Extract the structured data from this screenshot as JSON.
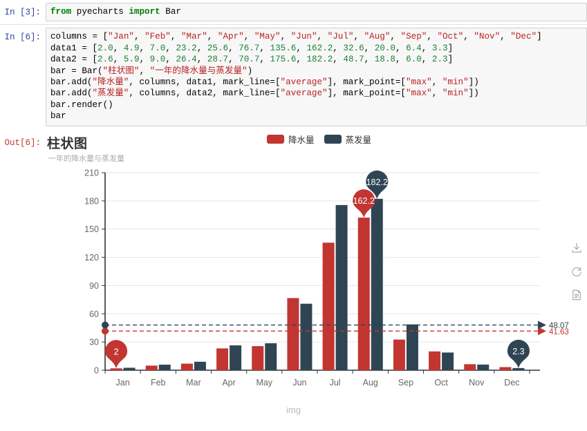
{
  "notebook": {
    "cells": [
      {
        "prompt": "In [3]:",
        "lines": [
          [
            {
              "t": "from ",
              "c": "k"
            },
            {
              "t": "pyecharts ",
              "c": "p"
            },
            {
              "t": "import ",
              "c": "k"
            },
            {
              "t": "Bar",
              "c": "p"
            }
          ]
        ]
      },
      {
        "prompt": "In [6]:",
        "lines": [
          [
            {
              "t": "columns = [",
              "c": "p"
            },
            {
              "t": "\"Jan\"",
              "c": "s"
            },
            {
              "t": ", ",
              "c": "p"
            },
            {
              "t": "\"Feb\"",
              "c": "s"
            },
            {
              "t": ", ",
              "c": "p"
            },
            {
              "t": "\"Mar\"",
              "c": "s"
            },
            {
              "t": ", ",
              "c": "p"
            },
            {
              "t": "\"Apr\"",
              "c": "s"
            },
            {
              "t": ", ",
              "c": "p"
            },
            {
              "t": "\"May\"",
              "c": "s"
            },
            {
              "t": ", ",
              "c": "p"
            },
            {
              "t": "\"Jun\"",
              "c": "s"
            },
            {
              "t": ", ",
              "c": "p"
            },
            {
              "t": "\"Jul\"",
              "c": "s"
            },
            {
              "t": ", ",
              "c": "p"
            },
            {
              "t": "\"Aug\"",
              "c": "s"
            },
            {
              "t": ", ",
              "c": "p"
            },
            {
              "t": "\"Sep\"",
              "c": "s"
            },
            {
              "t": ", ",
              "c": "p"
            },
            {
              "t": "\"Oct\"",
              "c": "s"
            },
            {
              "t": ", ",
              "c": "p"
            },
            {
              "t": "\"Nov\"",
              "c": "s"
            },
            {
              "t": ", ",
              "c": "p"
            },
            {
              "t": "\"Dec\"",
              "c": "s"
            },
            {
              "t": "]",
              "c": "p"
            }
          ],
          [
            {
              "t": "data1 = [",
              "c": "p"
            },
            {
              "t": "2.0",
              "c": "n"
            },
            {
              "t": ", ",
              "c": "p"
            },
            {
              "t": "4.9",
              "c": "n"
            },
            {
              "t": ", ",
              "c": "p"
            },
            {
              "t": "7.0",
              "c": "n"
            },
            {
              "t": ", ",
              "c": "p"
            },
            {
              "t": "23.2",
              "c": "n"
            },
            {
              "t": ", ",
              "c": "p"
            },
            {
              "t": "25.6",
              "c": "n"
            },
            {
              "t": ", ",
              "c": "p"
            },
            {
              "t": "76.7",
              "c": "n"
            },
            {
              "t": ", ",
              "c": "p"
            },
            {
              "t": "135.6",
              "c": "n"
            },
            {
              "t": ", ",
              "c": "p"
            },
            {
              "t": "162.2",
              "c": "n"
            },
            {
              "t": ", ",
              "c": "p"
            },
            {
              "t": "32.6",
              "c": "n"
            },
            {
              "t": ", ",
              "c": "p"
            },
            {
              "t": "20.0",
              "c": "n"
            },
            {
              "t": ", ",
              "c": "p"
            },
            {
              "t": "6.4",
              "c": "n"
            },
            {
              "t": ", ",
              "c": "p"
            },
            {
              "t": "3.3",
              "c": "n"
            },
            {
              "t": "]",
              "c": "p"
            }
          ],
          [
            {
              "t": "data2 = [",
              "c": "p"
            },
            {
              "t": "2.6",
              "c": "n"
            },
            {
              "t": ", ",
              "c": "p"
            },
            {
              "t": "5.9",
              "c": "n"
            },
            {
              "t": ", ",
              "c": "p"
            },
            {
              "t": "9.0",
              "c": "n"
            },
            {
              "t": ", ",
              "c": "p"
            },
            {
              "t": "26.4",
              "c": "n"
            },
            {
              "t": ", ",
              "c": "p"
            },
            {
              "t": "28.7",
              "c": "n"
            },
            {
              "t": ", ",
              "c": "p"
            },
            {
              "t": "70.7",
              "c": "n"
            },
            {
              "t": ", ",
              "c": "p"
            },
            {
              "t": "175.6",
              "c": "n"
            },
            {
              "t": ", ",
              "c": "p"
            },
            {
              "t": "182.2",
              "c": "n"
            },
            {
              "t": ", ",
              "c": "p"
            },
            {
              "t": "48.7",
              "c": "n"
            },
            {
              "t": ", ",
              "c": "p"
            },
            {
              "t": "18.8",
              "c": "n"
            },
            {
              "t": ", ",
              "c": "p"
            },
            {
              "t": "6.0",
              "c": "n"
            },
            {
              "t": ", ",
              "c": "p"
            },
            {
              "t": "2.3",
              "c": "n"
            },
            {
              "t": "]",
              "c": "p"
            }
          ],
          [
            {
              "t": "bar = Bar(",
              "c": "p"
            },
            {
              "t": "\"柱状图\"",
              "c": "s"
            },
            {
              "t": ", ",
              "c": "p"
            },
            {
              "t": "\"一年的降水量与蒸发量\"",
              "c": "s"
            },
            {
              "t": ")",
              "c": "p"
            }
          ],
          [
            {
              "t": "bar.add(",
              "c": "p"
            },
            {
              "t": "\"降水量\"",
              "c": "s"
            },
            {
              "t": ", columns, data1, mark_line=[",
              "c": "p"
            },
            {
              "t": "\"average\"",
              "c": "s"
            },
            {
              "t": "], mark_point=[",
              "c": "p"
            },
            {
              "t": "\"max\"",
              "c": "s"
            },
            {
              "t": ", ",
              "c": "p"
            },
            {
              "t": "\"min\"",
              "c": "s"
            },
            {
              "t": "])",
              "c": "p"
            }
          ],
          [
            {
              "t": "bar.add(",
              "c": "p"
            },
            {
              "t": "\"蒸发量\"",
              "c": "s"
            },
            {
              "t": ", columns, data2, mark_line=[",
              "c": "p"
            },
            {
              "t": "\"average\"",
              "c": "s"
            },
            {
              "t": "], mark_point=[",
              "c": "p"
            },
            {
              "t": "\"max\"",
              "c": "s"
            },
            {
              "t": ", ",
              "c": "p"
            },
            {
              "t": "\"min\"",
              "c": "s"
            },
            {
              "t": "])",
              "c": "p"
            }
          ],
          [
            {
              "t": "bar.render()",
              "c": "p"
            }
          ],
          [
            {
              "t": "bar",
              "c": "p"
            }
          ]
        ]
      }
    ],
    "output_prompt": "Out[6]:"
  },
  "toolbox": {
    "download_label": "download-icon",
    "restore_label": "restore-icon",
    "dataview_label": "data-view-icon"
  },
  "caption": "img",
  "chart_data": {
    "type": "bar",
    "title": "柱状图",
    "subtitle": "一年的降水量与蒸发量",
    "xlabel": "",
    "ylabel": "",
    "categories": [
      "Jan",
      "Feb",
      "Mar",
      "Apr",
      "May",
      "Jun",
      "Jul",
      "Aug",
      "Sep",
      "Oct",
      "Nov",
      "Dec"
    ],
    "yticks": [
      0,
      30,
      60,
      90,
      120,
      150,
      180,
      210
    ],
    "ylim": [
      0,
      210
    ],
    "grid": true,
    "legend_position": "top-center",
    "colors": {
      "series1": "#c23531",
      "series2": "#2f4554",
      "grid": "#e6e6e6",
      "axis": "#333333"
    },
    "series": [
      {
        "name": "降水量",
        "color": "#c23531",
        "values": [
          2.0,
          4.9,
          7.0,
          23.2,
          25.6,
          76.7,
          135.6,
          162.2,
          32.6,
          20.0,
          6.4,
          3.3
        ],
        "mark_line_average": 41.63,
        "mark_line_label": "41.63",
        "mark_point_max": {
          "label": "162.2",
          "category": "Aug",
          "value": 162.2
        },
        "mark_point_min": {
          "label": "2",
          "category": "Jan",
          "value": 2.0
        }
      },
      {
        "name": "蒸发量",
        "color": "#2f4554",
        "values": [
          2.6,
          5.9,
          9.0,
          26.4,
          28.7,
          70.7,
          175.6,
          182.2,
          48.7,
          18.8,
          6.0,
          2.3
        ],
        "mark_line_average": 48.07,
        "mark_line_label": "48.07",
        "mark_point_max": {
          "label": "182.2",
          "category": "Aug",
          "value": 182.2
        },
        "mark_point_min": {
          "label": "2.3",
          "category": "Dec",
          "value": 2.3
        }
      }
    ]
  }
}
